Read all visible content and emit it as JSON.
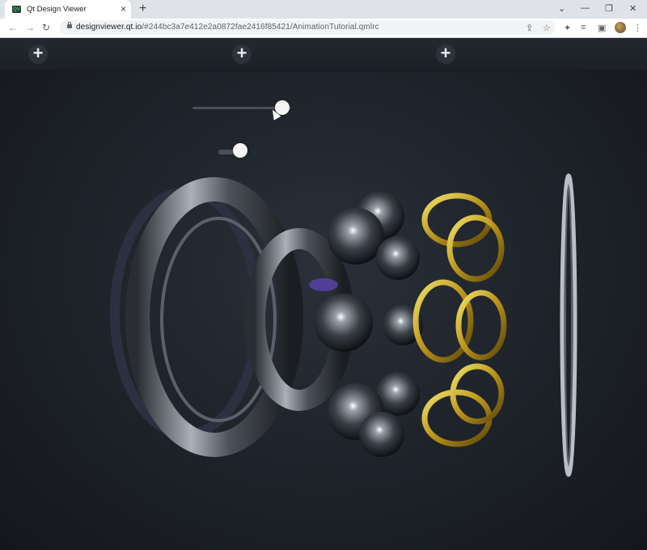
{
  "browser": {
    "tab_title": "Qt Design Viewer",
    "tab_favicon_text": "QV",
    "url_host": "designviewer.qt.io",
    "url_path": "/#244bc3a7e412e2a0872fae2416f85421/AnimationTutorial.qmlrc"
  },
  "toolbar": {
    "buttons": [
      "+",
      "+",
      "+"
    ]
  },
  "sliders": {
    "explode_value": 0.9,
    "toggle_value": 0.9
  },
  "colors": {
    "ring": "#9aa0a8",
    "cage": "#c9a81c",
    "background": "#1d2229"
  }
}
